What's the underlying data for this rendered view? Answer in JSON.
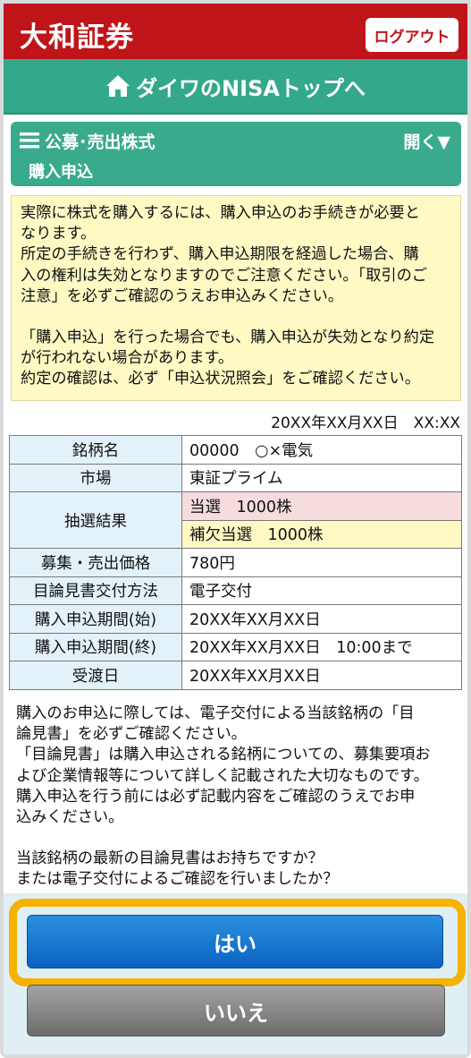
{
  "header": {
    "brand": "大和証券",
    "logout_label": "ログアウト"
  },
  "nav": {
    "nisa_top_label": "ダイワのNISAトップへ"
  },
  "section": {
    "title": "公募･売出株式",
    "toggle_label": "開く▼",
    "subtitle": "購入申込"
  },
  "notice": {
    "para1_line1": "実際に株式を購入するには、購入申込のお手続きが必要と",
    "para1_line2": "なります。",
    "para1_line3": "所定の手続きを行わず、購入申込期限を経過した場合、購",
    "para1_line4": "入の権利は失効となりますのでご注意ください。「取引のご",
    "para1_line5": "注意」を必ずご確認のうえお申込みください。",
    "para2_line1": "「購入申込」を行った場合でも、購入申込が失効となり約定",
    "para2_line2": "が行われない場合があります。",
    "para2_line3": "約定の確認は、必ず「申込状況照会」をご確認ください。"
  },
  "datetime": "20XX年XX月XX日　XX:XX",
  "table": {
    "rows": [
      {
        "label": "銘柄名",
        "value": "00000　○×電気"
      },
      {
        "label": "市場",
        "value": "東証プライム"
      },
      {
        "label": "抽選結果",
        "value": "当選　1000株",
        "value2": "補欠当選　1000株"
      },
      {
        "label": "募集・売出価格",
        "value": "780円"
      },
      {
        "label": "目論見書交付方法",
        "value": "電子交付"
      },
      {
        "label": "購入申込期間(始)",
        "value": "20XX年XX月XX日"
      },
      {
        "label": "購入申込期間(終)",
        "value": "20XX年XX月XX日　10:00まで"
      },
      {
        "label": "受渡日",
        "value": "20XX年XX月XX日"
      }
    ]
  },
  "description": {
    "line1": "購入のお申込に際しては、電子交付による当該銘柄の「目",
    "line2": "論見書」を必ずご確認ください。",
    "line3": "「目論見書」は購入申込される銘柄についての、募集要項お",
    "line4": "よび企業情報等について詳しく記載された大切なものです。",
    "line5": "購入申込を行う前には必ず記載内容をご確認のうえでお申",
    "line6": "込みください。",
    "line7": "当該銘柄の最新の目論見書はお持ちですか？",
    "line8": "または電子交付によるご確認を行いましたか？"
  },
  "buttons": {
    "yes_label": "はい",
    "no_label": "いいえ"
  },
  "colors": {
    "brand_red": "#c0141b",
    "nisa_green": "#34a88a",
    "highlight_orange": "#f5b300",
    "yes_blue": "#0a63c1"
  }
}
